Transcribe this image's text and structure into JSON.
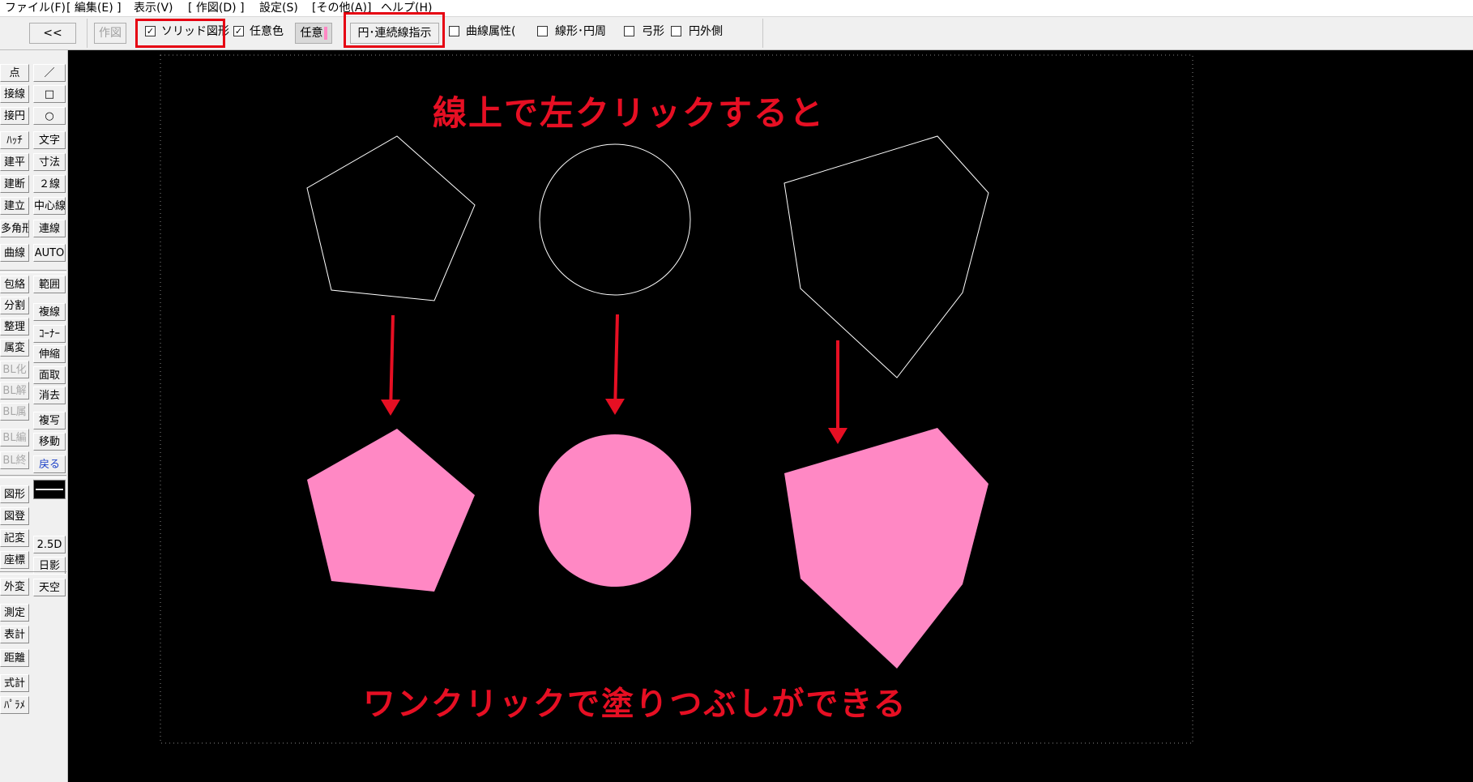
{
  "menu": {
    "items": [
      {
        "label": "ファイル(F)"
      },
      {
        "label": "[ 編集(E) ]"
      },
      {
        "label": "表示(V)"
      },
      {
        "label": "[ 作図(D) ]"
      },
      {
        "label": "設定(S)"
      },
      {
        "label": "[その他(A)]"
      },
      {
        "label": "ヘルプ(H)"
      }
    ]
  },
  "toolbar": {
    "back_label": "<<",
    "draw_label": "作図",
    "solid_label": "ソリッド図形",
    "solid_checked": "✓",
    "anycolor_label": "任意色",
    "anycolor_checked": "✓",
    "anycolor_button": "任意",
    "anycolor_swatch": "#ff88c4",
    "circle_continuous_label": "円･連続線指示",
    "curve_attr_label": "曲線属性(",
    "linear_circle_label": "線形･円周",
    "arc_label": "弓形",
    "outer_circle_label": "円外側"
  },
  "palette": {
    "col1": [
      "点",
      "接線",
      "接円",
      "ﾊｯﾁ",
      "建平",
      "建断",
      "建立",
      "多角形",
      "曲線",
      "包絡",
      "分割",
      "整理",
      "属変",
      "BL化",
      "BL解",
      "BL属",
      "BL編",
      "BL終",
      "図形",
      "図登",
      "記変",
      "座標",
      "外変",
      "測定",
      "表計",
      "距離",
      "式計",
      "ﾊﾟﾗﾒ"
    ],
    "col2": [
      "／",
      "□",
      "○",
      "文字",
      "寸法",
      "２線",
      "中心線",
      "連線",
      "AUTO",
      "範囲",
      "複線",
      "ｺｰﾅｰ",
      "伸縮",
      "面取",
      "消去",
      "複写",
      "移動",
      "戻る",
      "2.5D",
      "日影",
      "天空"
    ]
  },
  "canvas": {
    "caption_top": "線上で左クリックすると",
    "caption_bottom": "ワンクリックで塗りつぶしができる",
    "outline_color": "#ffffff",
    "fill_color": "#ff88c4",
    "arrow_color": "#e60f23",
    "background": "#000000"
  }
}
